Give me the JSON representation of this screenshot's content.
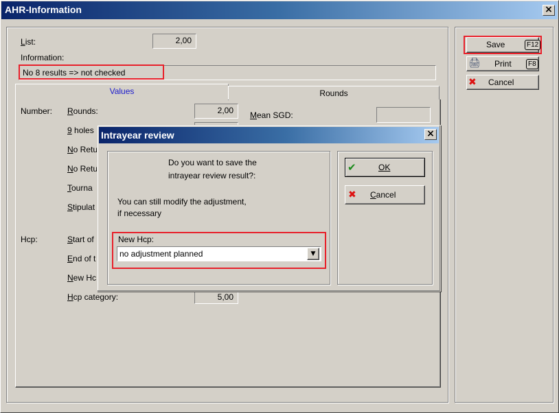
{
  "window": {
    "title": "AHR-Information",
    "close": "×"
  },
  "form": {
    "list_label": "List:",
    "list_value": "2,00",
    "information_label": "Information:",
    "information_value": "No 8 results => not checked"
  },
  "tabs": [
    {
      "label": "Values",
      "active": true
    },
    {
      "label": "Rounds",
      "active": false
    }
  ],
  "values": {
    "number_label": "Number:",
    "rounds_label": "Rounds:",
    "rounds_value": "2,00",
    "nine_holes_label": "9 holes",
    "no_return_1": "No Retu",
    "no_return_2": "No Retu",
    "tourna_label": "Tourna",
    "stipulat_label": "Stipulat",
    "mean_sgd_label": "Mean SGD:",
    "hcp_label": "Hcp:",
    "start_of_label": "Start of",
    "end_of_label": "End of t",
    "new_hc_label": "New Hc",
    "hcp_category_label": "Hcp category:",
    "hcp_category_value": "5,00"
  },
  "actions": {
    "save": "Save",
    "save_key": "F12",
    "print": "Print",
    "print_key": "F8",
    "cancel": "Cancel"
  },
  "dialog": {
    "title": "Intrayear review",
    "close": "×",
    "question_line1": "Do you want to save the",
    "question_line2": "intrayear review result?:",
    "info_line1": "You can still modify the adjustment,",
    "info_line2": "if necessary",
    "new_hcp_label": "New Hcp:",
    "new_hcp_value": "no adjustment planned",
    "ok": "OK",
    "cancel": "Cancel"
  },
  "icons": {
    "check": "✔",
    "x": "✖",
    "dropdown": "▼",
    "printer": "🖨"
  },
  "colors": {
    "highlight": "#e8202a",
    "tab_active_text": "#1a1acc",
    "title_bar": "#0a246a"
  }
}
